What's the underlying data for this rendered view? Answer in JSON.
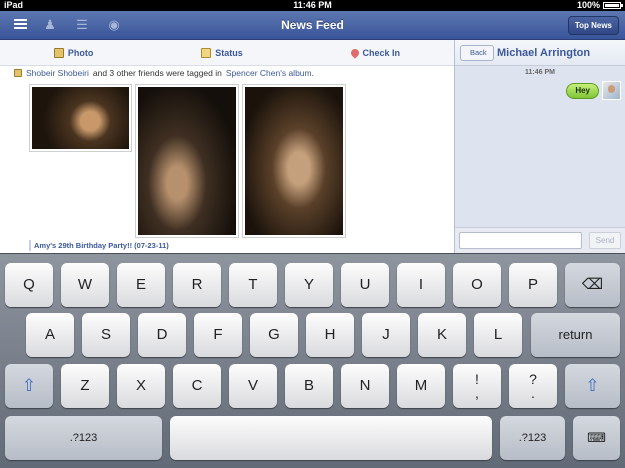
{
  "status_bar": {
    "carrier": "iPad",
    "time": "11:46 PM",
    "battery": "100%"
  },
  "nav": {
    "title": "News Feed",
    "top_news_label": "Top News"
  },
  "composer": {
    "photo": "Photo",
    "status": "Status",
    "check_in": "Check In"
  },
  "story": {
    "actor": "Shobeir Shobeiri",
    "middle": "and 3 other friends were tagged in",
    "album_link": "Spencer Chen's album",
    "end": ".",
    "album_title": "Amy's 29th Birthday Party!! (07-23-11)"
  },
  "chat": {
    "back_label": "Back",
    "name": "Michael Arrington",
    "time": "11:46 PM",
    "messages": [
      {
        "text": "Hey"
      }
    ],
    "input_placeholder": "",
    "send_label": "Send"
  },
  "keyboard": {
    "row1": [
      "Q",
      "W",
      "E",
      "R",
      "T",
      "Y",
      "U",
      "I",
      "O",
      "P"
    ],
    "row2": [
      "A",
      "S",
      "D",
      "F",
      "G",
      "H",
      "J",
      "K",
      "L"
    ],
    "row3": [
      "Z",
      "X",
      "C",
      "V",
      "B",
      "N",
      "M"
    ],
    "return_label": "return",
    "numbers_label": ".?123",
    "punct1": {
      "top": "!",
      "bottom": ","
    },
    "punct2": {
      "top": "?",
      "bottom": "."
    }
  },
  "icons": {
    "menu": "menu-icon",
    "friends": "friends-icon",
    "messages": "messages-icon",
    "notifications": "globe-icon",
    "shift": "shift-arrow-icon",
    "delete": "delete-key-icon",
    "hide_keyboard": "hide-keyboard-icon"
  }
}
